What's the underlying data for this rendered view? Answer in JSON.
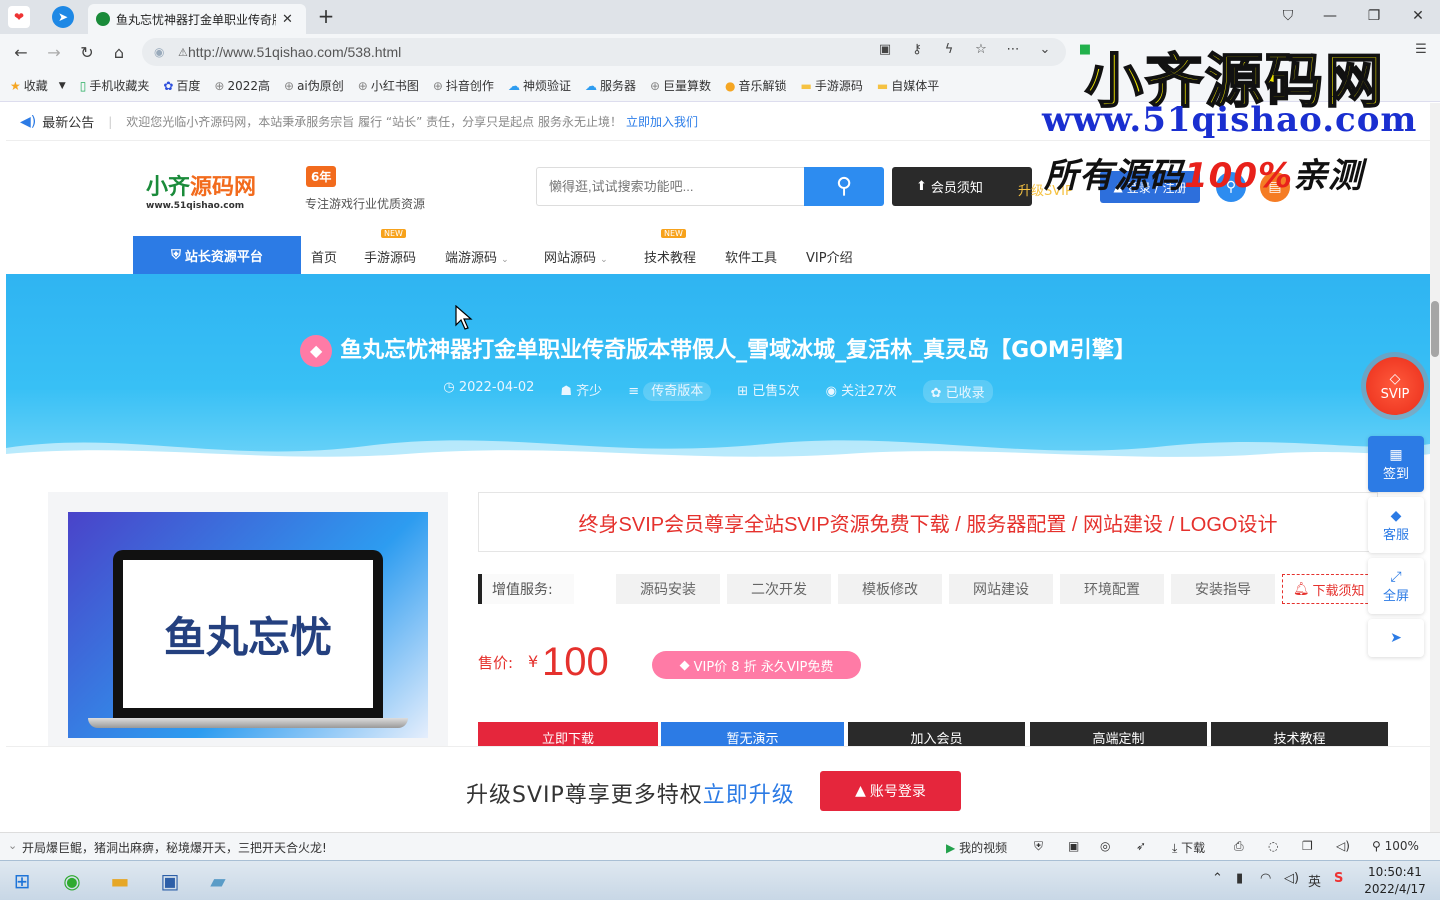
{
  "browser": {
    "active_tab_title": "鱼丸忘忧神器打金单职业传奇版",
    "url": "http://www.51qishao.com/538.html",
    "bookmarks": [
      {
        "label": "收藏",
        "icon": "star-icon"
      },
      {
        "label": "手机收藏夹",
        "icon": "phone-icon"
      },
      {
        "label": "百度",
        "icon": "paw-icon"
      },
      {
        "label": "2022高",
        "icon": "globe-icon"
      },
      {
        "label": "ai伪原创",
        "icon": "globe-icon"
      },
      {
        "label": "小红书图",
        "icon": "globe-icon"
      },
      {
        "label": "抖音创作",
        "icon": "globe-icon"
      },
      {
        "label": "神烦验证",
        "icon": "cloud-icon"
      },
      {
        "label": "服务器",
        "icon": "cloud-icon"
      },
      {
        "label": "巨量算数",
        "icon": "globe-icon"
      },
      {
        "label": "音乐解锁",
        "icon": "music-icon"
      },
      {
        "label": "手游源码",
        "icon": "folder-icon"
      },
      {
        "label": "自媒体平",
        "icon": "folder-icon"
      }
    ]
  },
  "watermark": {
    "line1": "小齐源码网",
    "line2": "www.51qishao.com",
    "line3_a": "所有源码",
    "line3_b": "100%",
    "line3_c": "亲测"
  },
  "notice": {
    "title": "最新公告",
    "message": "欢迎您光临小齐源码网，本站秉承服务宗旨 履行 “站长” 责任，分享只是起点 服务永无止境！",
    "link": "立即加入我们"
  },
  "header": {
    "logo_a": "小齐",
    "logo_b": "源码网",
    "logo_url": "www.51qishao.com",
    "years_badge": "6年",
    "slogan": "专注游戏行业优质资源",
    "search_placeholder": "懒得逛,试试搜索功能吧...",
    "member_button": "会员须知",
    "upgrade_badge": "升级SVIP",
    "login_button": "登录 / 注册"
  },
  "nav": {
    "platform": "站长资源平台",
    "items": [
      "首页",
      "手游源码",
      "端游源码",
      "网站源码",
      "技术教程",
      "软件工具",
      "VIP介绍"
    ],
    "new_badge": "NEW"
  },
  "post": {
    "title": "鱼丸忘忧神器打金单职业传奇版本带假人_雪域冰城_复活林_真灵岛【GOM引擎】",
    "date": "2022-04-02",
    "author": "齐少",
    "category": "传奇版本",
    "sold": "已售5次",
    "follows": "关注27次",
    "indexed": "已收录",
    "thumb_text": "鱼丸忘忧",
    "promo": "终身SVIP会员尊享全站SVIP资源免费下载 / 服务器配置 / 网站建设 / LOGO设计",
    "services_label": "增值服务:",
    "services": [
      "源码安装",
      "二次开发",
      "模板修改",
      "网站建设",
      "环境配置",
      "安装指导"
    ],
    "download_notice": "下载须知",
    "price_label": "售价:",
    "currency": "¥",
    "price": "100",
    "vip_pill": "VIP价 8 折 永久VIP免费",
    "actions": [
      "立即下载",
      "暂无演示",
      "加入会员",
      "高端定制",
      "技术教程"
    ]
  },
  "bottom_bar": {
    "text": "升级SVIP尊享更多特权",
    "link": "立即升级",
    "button": "账号登录"
  },
  "float": {
    "svip": "SVIP",
    "sign": "签到",
    "service": "客服",
    "fullscreen": "全屏"
  },
  "statusbar": {
    "news": "开局爆巨鲲，猪洞出麻痹，秘境爆开天，三把开天合火龙!",
    "video": "我的视频",
    "download": "下载",
    "zoom": "100%"
  },
  "taskbar": {
    "ime": "英",
    "time": "10:50:41",
    "date": "2022/4/17"
  },
  "colors": {
    "accent": "#2c7be5",
    "price_red": "#e5312d",
    "banner": "#38c0f5"
  }
}
